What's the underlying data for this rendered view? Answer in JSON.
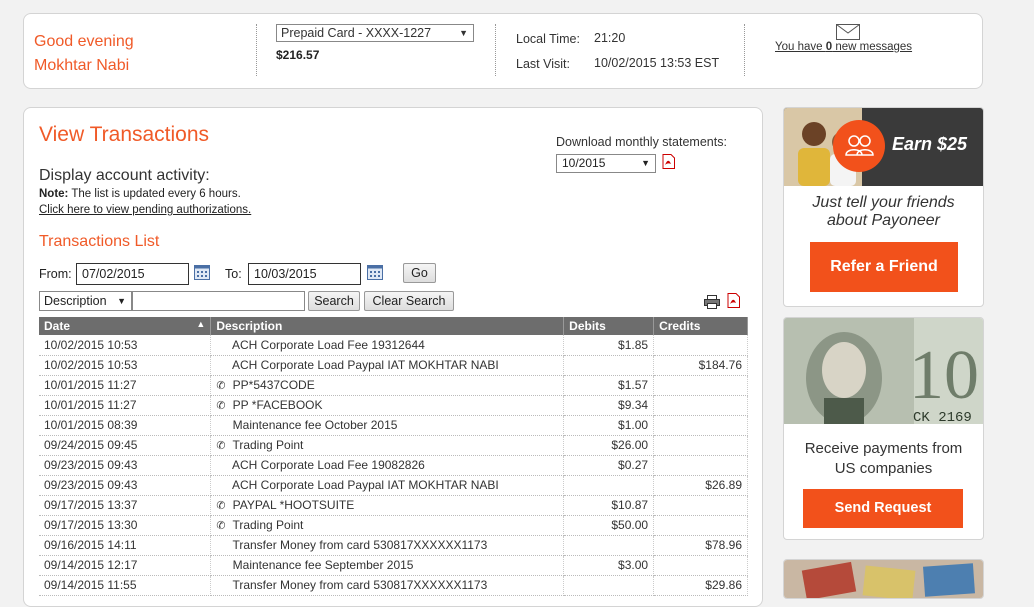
{
  "header": {
    "greeting": "Good evening",
    "user_name": "Mokhtar Nabi",
    "card_selected": "Prepaid Card - XXXX-1227",
    "balance": "$216.57",
    "local_time_label": "Local Time:",
    "local_time": "21:20",
    "last_visit_label": "Last Visit:",
    "last_visit": "10/02/2015 13:53 EST",
    "messages_prefix": "You have ",
    "messages_count": "0",
    "messages_suffix": " new messages"
  },
  "main": {
    "title": "View Transactions",
    "download_label": "Download monthly statements:",
    "month_selected": "10/2015",
    "display_activity": "Display account activity:",
    "note_label": "Note:",
    "note_text": " The list is updated every 6 hours.",
    "pending_link": "Click here to view pending authorizations.",
    "list_title": "Transactions List",
    "from_label": "From:",
    "from_value": "07/02/2015",
    "to_label": "To:",
    "to_value": "10/03/2015",
    "go_label": "Go",
    "search_field_selected": "Description",
    "search_label": "Search",
    "clear_search_label": "Clear Search"
  },
  "table": {
    "columns": [
      "Date",
      "Description",
      "Debits",
      "Credits"
    ],
    "rows": [
      {
        "date": "10/02/2015 10:53",
        "phone": false,
        "desc": "ACH Corporate Load Fee 19312644",
        "debit": "$1.85",
        "credit": ""
      },
      {
        "date": "10/02/2015 10:53",
        "phone": false,
        "desc": "ACH Corporate Load Paypal IAT MOKHTAR NABI",
        "debit": "",
        "credit": "$184.76"
      },
      {
        "date": "10/01/2015 11:27",
        "phone": true,
        "desc": "PP*5437CODE",
        "debit": "$1.57",
        "credit": ""
      },
      {
        "date": "10/01/2015 11:27",
        "phone": true,
        "desc": "PP *FACEBOOK",
        "debit": "$9.34",
        "credit": ""
      },
      {
        "date": "10/01/2015 08:39",
        "phone": false,
        "desc": "Maintenance fee October 2015",
        "debit": "$1.00",
        "credit": ""
      },
      {
        "date": "09/24/2015 09:45",
        "phone": true,
        "desc": "Trading Point",
        "debit": "$26.00",
        "credit": ""
      },
      {
        "date": "09/23/2015 09:43",
        "phone": false,
        "desc": "ACH Corporate Load Fee 19082826",
        "debit": "$0.27",
        "credit": ""
      },
      {
        "date": "09/23/2015 09:43",
        "phone": false,
        "desc": "ACH Corporate Load Paypal IAT MOKHTAR NABI",
        "debit": "",
        "credit": "$26.89"
      },
      {
        "date": "09/17/2015 13:37",
        "phone": true,
        "desc": "PAYPAL *HOOTSUITE",
        "debit": "$10.87",
        "credit": ""
      },
      {
        "date": "09/17/2015 13:30",
        "phone": true,
        "desc": "Trading Point",
        "debit": "$50.00",
        "credit": ""
      },
      {
        "date": "09/16/2015 14:11",
        "phone": false,
        "desc": "Transfer Money from card 530817XXXXXX1173",
        "debit": "",
        "credit": "$78.96"
      },
      {
        "date": "09/14/2015 12:17",
        "phone": false,
        "desc": "Maintenance fee September 2015",
        "debit": "$3.00",
        "credit": ""
      },
      {
        "date": "09/14/2015 11:55",
        "phone": false,
        "desc": "Transfer Money from card 530817XXXXXX1173",
        "debit": "",
        "credit": "$29.86"
      }
    ]
  },
  "sidebar": {
    "earn_badge": "Earn $25",
    "refer_text": "Just tell your friends about Payoneer",
    "refer_button": "Refer a Friend",
    "payments_text": "Receive payments from US companies",
    "send_button": "Send Request",
    "banknote_serial": "CK 2169"
  },
  "colors": {
    "accent": "#f05a28",
    "button": "#f2511b",
    "debit": "#cc0000",
    "credit": "#2a8a2a",
    "table_header": "#6d6d6d"
  }
}
